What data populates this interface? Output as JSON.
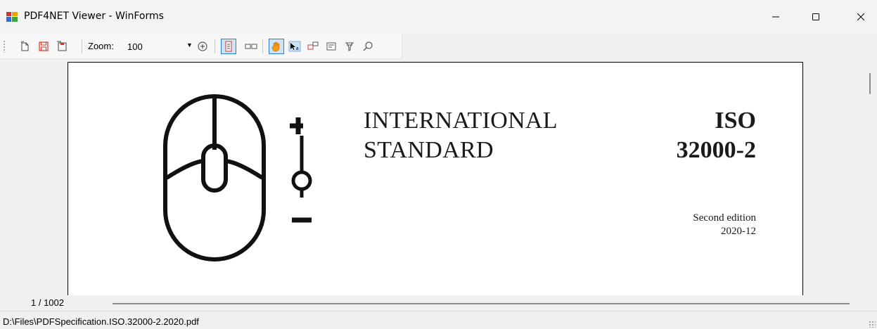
{
  "window": {
    "title": "PDF4NET Viewer - WinForms",
    "controls": {
      "minimize": "—",
      "maximize": "☐",
      "close": "✕"
    }
  },
  "toolbar": {
    "zoom_label": "Zoom:",
    "zoom_value": "100",
    "zoom_dropdown_icon": "caret-down-icon",
    "checked_color": "#cce4f7",
    "checked_border": "#2d7fd3",
    "buttons": [
      {
        "name": "open-file-button",
        "icon": "open-file-icon"
      },
      {
        "name": "save-button",
        "icon": "save-icon"
      },
      {
        "name": "save-as-button",
        "icon": "save-as-icon"
      },
      {
        "name": "zoom-dropdown-button",
        "icon": "zoom-dropdown-icon"
      },
      {
        "name": "single-page-view-button",
        "icon": "single-page-icon",
        "checked": true
      },
      {
        "name": "two-page-view-button",
        "icon": "two-page-icon"
      },
      {
        "name": "pan-tool-button",
        "icon": "hand-icon",
        "checked": true
      },
      {
        "name": "text-select-tool-button",
        "icon": "text-select-icon"
      },
      {
        "name": "annotation-tool-button",
        "icon": "annotation-icon"
      },
      {
        "name": "form-fields-button",
        "icon": "form-icon"
      },
      {
        "name": "highlight-tool-button",
        "icon": "highlighter-icon"
      },
      {
        "name": "search-button",
        "icon": "search-icon"
      }
    ]
  },
  "document": {
    "heading_line1": "INTERNATIONAL",
    "heading_line2": "STANDARD",
    "code_line1": "ISO",
    "code_line2": "32000-2",
    "edition_line1": "Second edition",
    "edition_line2": "2020-12",
    "cover_art_icon": "mouse-scroll-zoom-icon"
  },
  "navigation": {
    "page_indicator": "1 / 1002"
  },
  "statusbar": {
    "file_path": "D:\\Files\\PDFSpecification.ISO.32000-2.2020.pdf"
  }
}
